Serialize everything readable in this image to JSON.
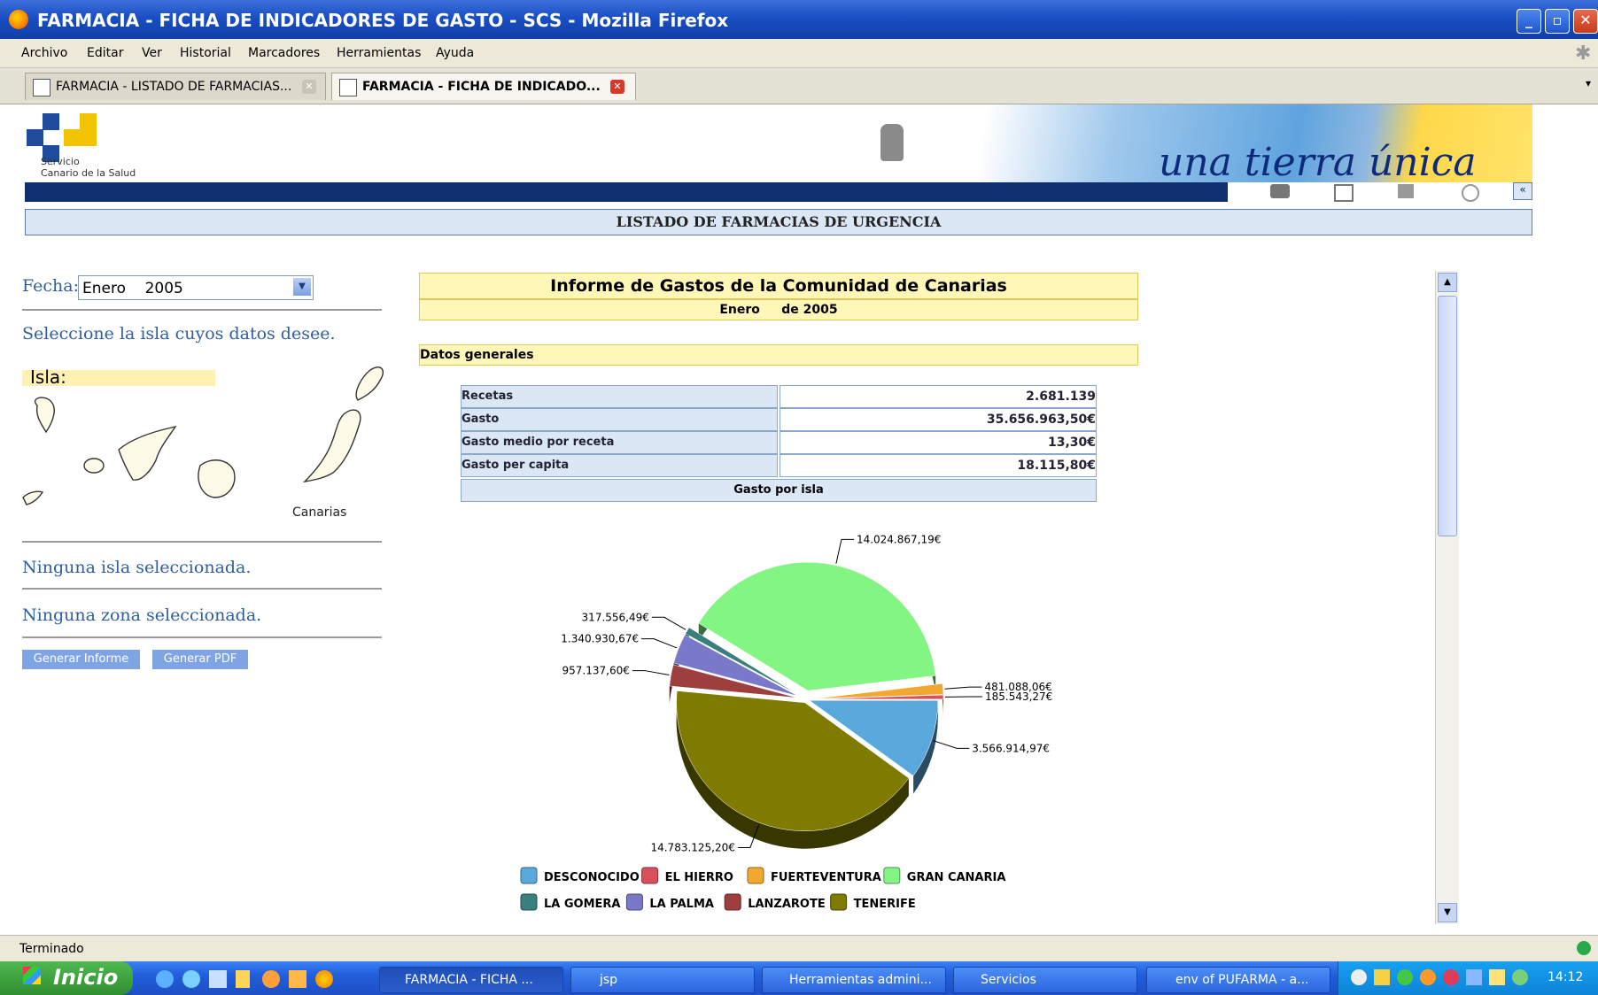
{
  "window": {
    "title": "FARMACIA - FICHA DE INDICADORES DE GASTO - SCS - Mozilla Firefox"
  },
  "menu": [
    "Archivo",
    "Editar",
    "Ver",
    "Historial",
    "Marcadores",
    "Herramientas",
    "Ayuda"
  ],
  "tabs": [
    {
      "label": "FARMACIA - LISTADO DE FARMACIAS...",
      "active": false
    },
    {
      "label": "FARMACIA - FICHA DE INDICADO...",
      "active": true
    }
  ],
  "header": {
    "logo_line1": "Servicio",
    "logo_line2": "Canario de la Salud",
    "slogan": "una tierra única",
    "section_title": "LISTADO DE FARMACIAS DE URGENCIA"
  },
  "sidebar": {
    "fecha_label": "Fecha:",
    "fecha_value": "Enero    2005",
    "instruction": "Seleccione la isla cuyos datos desee.",
    "isla_label": "Isla:",
    "map_label": "Canarias",
    "status_isla": "Ninguna isla seleccionada.",
    "status_zona": "Ninguna zona seleccionada.",
    "btn_informe": "Generar Informe",
    "btn_pdf": "Generar PDF"
  },
  "report": {
    "title": "Informe de Gastos de la Comunidad de Canarias",
    "subtitle": "Enero     de 2005",
    "section": "Datos generales",
    "rows": [
      {
        "label": "Recetas",
        "value": "2.681.139"
      },
      {
        "label": "Gasto",
        "value": "35.656.963,50€"
      },
      {
        "label": "Gasto medio por receta",
        "value": "13,30€"
      },
      {
        "label": "Gasto per capita",
        "value": "18.115,80€"
      }
    ],
    "chart_header": "Gasto por isla"
  },
  "chart_data": {
    "type": "pie",
    "categories": [
      "DESCONOCIDO",
      "EL HIERRO",
      "FUERTEVENTURA",
      "GRAN CANARIA",
      "LA GOMERA",
      "LA PALMA",
      "LANZAROTE",
      "TENERIFE"
    ],
    "values": [
      3566914.97,
      185543.27,
      481088.06,
      14024867.19,
      317556.49,
      1340930.67,
      957137.6,
      14783125.2
    ],
    "labels": [
      "3.566.914,97€",
      "185.543,27€",
      "481.088,06€",
      "14.024.867,19€",
      "317.556,49€",
      "1.340.930,67€",
      "957.137,60€",
      "14.783.125,20€"
    ],
    "colors": [
      "#5aa9dd",
      "#d94f5c",
      "#f2a830",
      "#82f582",
      "#3a7f7f",
      "#7a78c8",
      "#9e3f3f",
      "#7f7a00"
    ],
    "legend_position": "bottom"
  },
  "status": {
    "text": "Terminado"
  },
  "taskbar": {
    "start": "Inicio",
    "items": [
      "FARMACIA - FICHA ...",
      "jsp",
      "Herramientas admini...",
      "Servicios",
      "env of PUFARMA - a..."
    ],
    "clock": "14:12"
  }
}
